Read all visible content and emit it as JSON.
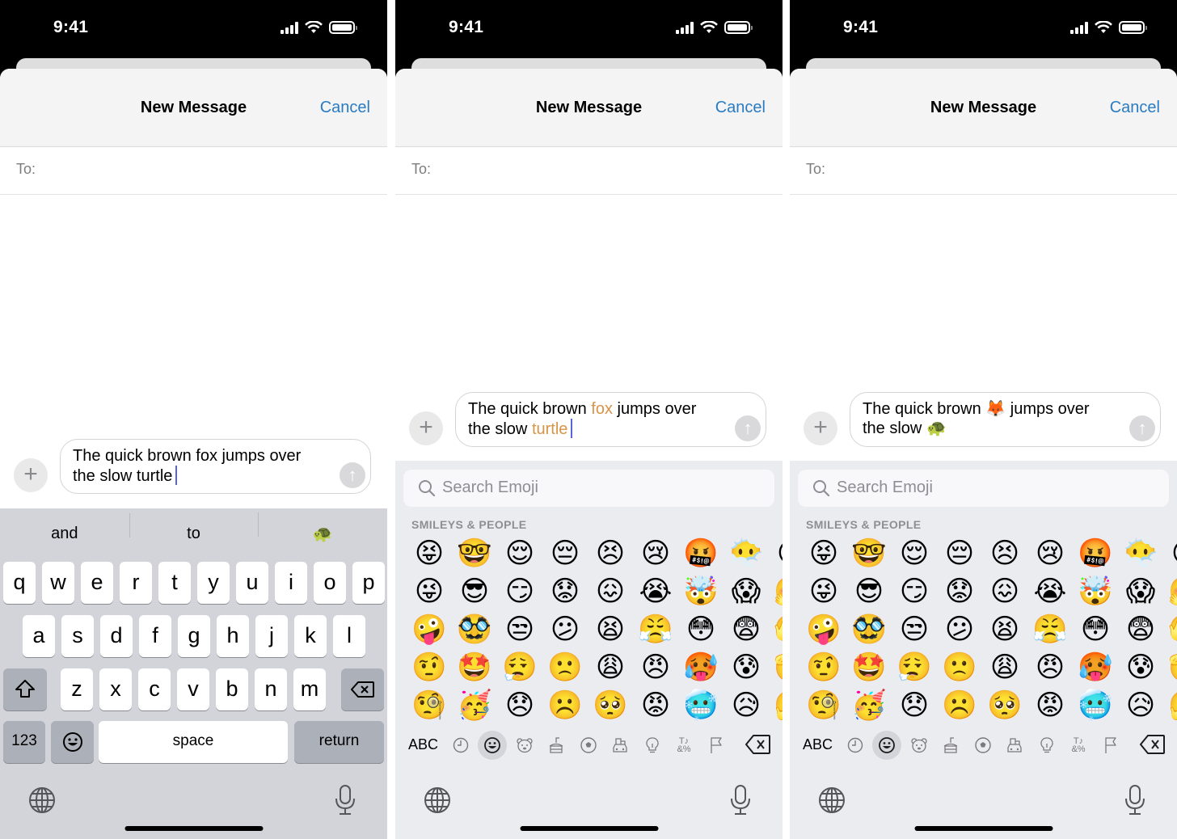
{
  "status_bar": {
    "time": "9:41"
  },
  "header": {
    "title": "New Message",
    "cancel_label": "Cancel"
  },
  "recipient": {
    "label": "To:"
  },
  "colors": {
    "accent": "#2a7bc1",
    "highlight": "#d89447",
    "caret": "#5865d6"
  },
  "panels": [
    {
      "message": {
        "line1": "The quick brown fox jumps over",
        "line2": "the slow turtle"
      },
      "keyboard": {
        "suggestions": [
          "and",
          "to",
          "🐢"
        ],
        "row1": [
          "q",
          "w",
          "e",
          "r",
          "t",
          "y",
          "u",
          "i",
          "o",
          "p"
        ],
        "row2": [
          "a",
          "s",
          "d",
          "f",
          "g",
          "h",
          "j",
          "k",
          "l"
        ],
        "row3": [
          "z",
          "x",
          "c",
          "v",
          "b",
          "n",
          "m"
        ],
        "numbers_label": "123",
        "space_label": "space",
        "return_label": "return"
      }
    },
    {
      "message": {
        "part1": "The quick brown ",
        "word1": "fox",
        "part2": " jumps over",
        "part3": "the slow ",
        "word2": "turtle"
      }
    },
    {
      "message": {
        "part1": "The quick brown ",
        "emoji1": "🦊",
        "part2": " jumps over",
        "part3": "the slow ",
        "emoji2": "🐢"
      }
    }
  ],
  "emoji_keyboard": {
    "search_placeholder": "Search Emoji",
    "category_title": "SMILEYS & PEOPLE",
    "abc_label": "ABC",
    "categories": [
      "recent-clock",
      "smileys",
      "animals",
      "food",
      "activity",
      "travel",
      "objects",
      "symbols",
      "flags"
    ],
    "active_category": "smileys",
    "grid_rows": [
      [
        "😝",
        "🤓",
        "😌",
        "😔",
        "😣",
        "😢",
        "🤬",
        "😶‍🌫️",
        "😓"
      ],
      [
        "😜",
        "😎",
        "😏",
        "😟",
        "😖",
        "😭",
        "🤯",
        "😱",
        "🤗"
      ],
      [
        "🤪",
        "🥸",
        "😒",
        "😕",
        "😫",
        "😤",
        "😳",
        "😨",
        "🫣"
      ],
      [
        "🤨",
        "🤩",
        "😮‍💨",
        "🙁",
        "😩",
        "😠",
        "🥵",
        "😰",
        "🫡"
      ],
      [
        "🧐",
        "🥳",
        "😞",
        "☹️",
        "🥺",
        "😡",
        "🥶",
        "😥",
        "🤔"
      ]
    ]
  }
}
